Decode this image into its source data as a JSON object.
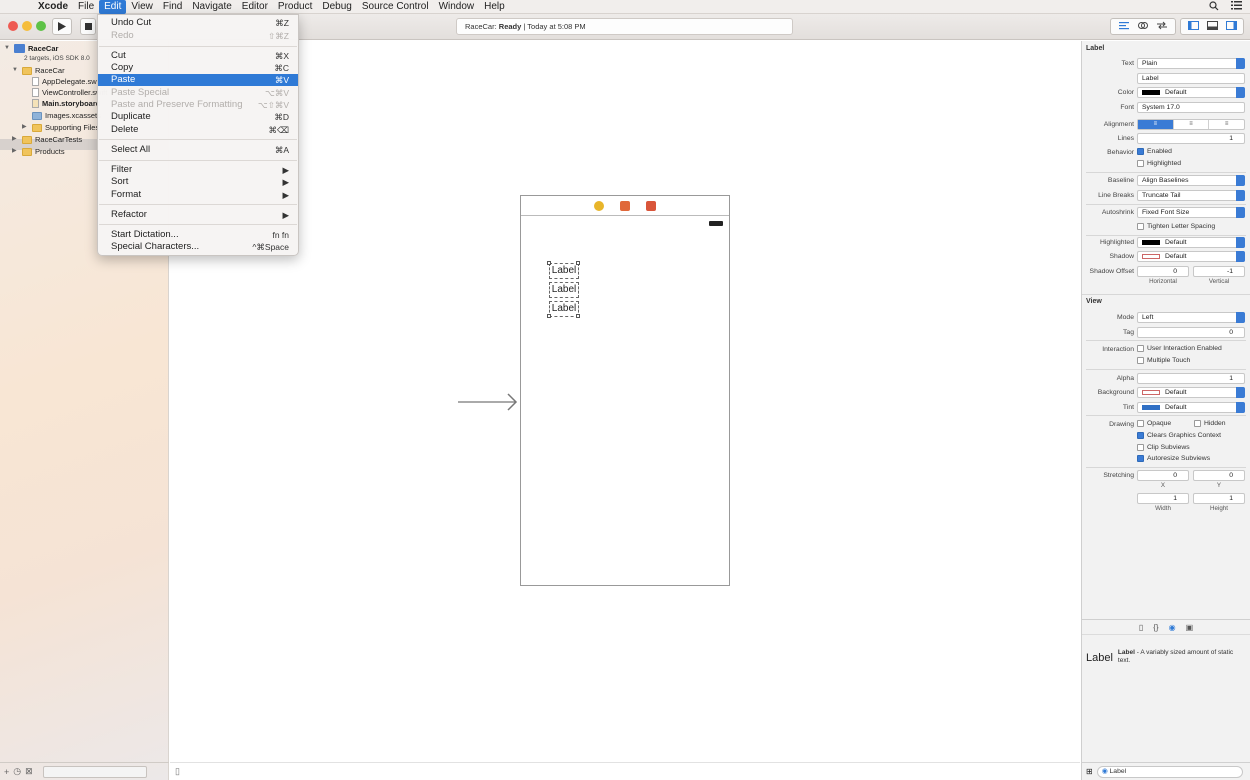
{
  "menubar": {
    "apple": "",
    "app": "Xcode",
    "items": [
      "File",
      "Edit",
      "View",
      "Find",
      "Navigate",
      "Editor",
      "Product",
      "Debug",
      "Source Control",
      "Window",
      "Help"
    ],
    "active": "Edit"
  },
  "toolbar": {
    "activity_project": "RaceCar:",
    "activity_status": "Ready",
    "activity_time": "Today at 5:08 PM"
  },
  "navigator": {
    "project": "RaceCar",
    "project_sub": "2 targets, iOS SDK 8.0",
    "group": "RaceCar",
    "files": [
      "AppDelegate.swift",
      "ViewController.swift",
      "Main.storyboard",
      "Images.xcassets",
      "Supporting Files"
    ],
    "groups": [
      "RaceCarTests",
      "Products"
    ],
    "selected": "Main.storyboard"
  },
  "edit_menu": {
    "items": [
      {
        "label": "Undo Cut",
        "shortcut": "⌘Z",
        "disabled": false
      },
      {
        "label": "Redo",
        "shortcut": "⇧⌘Z",
        "disabled": true
      },
      {
        "label": "Cut",
        "shortcut": "⌘X",
        "disabled": false
      },
      {
        "label": "Copy",
        "shortcut": "⌘C",
        "disabled": false
      },
      {
        "label": "Paste",
        "shortcut": "⌘V",
        "disabled": false,
        "highlighted": true
      },
      {
        "label": "Paste Special",
        "shortcut": "⌥⌘V",
        "disabled": true
      },
      {
        "label": "Paste and Preserve Formatting",
        "shortcut": "⌥⇧⌘V",
        "disabled": true
      },
      {
        "label": "Duplicate",
        "shortcut": "⌘D",
        "disabled": false
      },
      {
        "label": "Delete",
        "shortcut": "⌘⌫",
        "disabled": false
      },
      {
        "label": "Select All",
        "shortcut": "⌘A",
        "disabled": false
      },
      {
        "label": "Filter",
        "shortcut": "▶",
        "disabled": false
      },
      {
        "label": "Sort",
        "shortcut": "▶",
        "disabled": false
      },
      {
        "label": "Format",
        "shortcut": "▶",
        "disabled": false
      },
      {
        "label": "Refactor",
        "shortcut": "▶",
        "disabled": false
      },
      {
        "label": "Start Dictation...",
        "shortcut": "fn fn",
        "disabled": false
      },
      {
        "label": "Special Characters...",
        "shortcut": "^⌘Space",
        "disabled": false
      }
    ]
  },
  "canvas": {
    "labels": [
      "Label",
      "Label",
      "Label"
    ]
  },
  "inspector": {
    "label_section": "Label",
    "text_label": "Text",
    "text_value": "Plain",
    "text_content": "Label",
    "color_label": "Color",
    "color_value": "Default",
    "font_label": "Font",
    "font_value": "System 17.0",
    "alignment_label": "Alignment",
    "lines_label": "Lines",
    "lines_value": "1",
    "behavior_label": "Behavior",
    "enabled": "Enabled",
    "highlighted": "Highlighted",
    "baseline_label": "Baseline",
    "baseline_value": "Align Baselines",
    "linebreaks_label": "Line Breaks",
    "linebreaks_value": "Truncate Tail",
    "autoshrink_label": "Autoshrink",
    "autoshrink_value": "Fixed Font Size",
    "tighten": "Tighten Letter Spacing",
    "highlighted_label": "Highlighted",
    "highlighted_value": "Default",
    "shadow_label": "Shadow",
    "shadow_value": "Default",
    "shadow_offset_label": "Shadow Offset",
    "shadow_h": "0",
    "shadow_v": "-1",
    "horizontal": "Horizontal",
    "vertical": "Vertical",
    "view_section": "View",
    "mode_label": "Mode",
    "mode_value": "Left",
    "tag_label": "Tag",
    "tag_value": "0",
    "interaction_label": "Interaction",
    "user_interaction": "User Interaction Enabled",
    "multiple_touch": "Multiple Touch",
    "alpha_label": "Alpha",
    "alpha_value": "1",
    "background_label": "Background",
    "background_value": "Default",
    "tint_label": "Tint",
    "tint_value": "Default",
    "drawing_label": "Drawing",
    "opaque": "Opaque",
    "hidden": "Hidden",
    "clears": "Clears Graphics Context",
    "clip": "Clip Subviews",
    "autoresize": "Autoresize Subviews",
    "stretching_label": "Stretching",
    "stretch_x": "0",
    "stretch_y": "0",
    "x": "X",
    "y": "Y",
    "stretch_w": "1",
    "stretch_h": "1",
    "width": "Width",
    "height": "Height",
    "library_title": "Label",
    "library_name": "Label",
    "library_desc": " - A variably sized amount of static text.",
    "library_search": "Label"
  },
  "colors": {
    "accent": "#2f7ad6",
    "dock_yellow": "#e8b52a",
    "dock_orange": "#e0683a",
    "dock_red": "#d9553a"
  }
}
